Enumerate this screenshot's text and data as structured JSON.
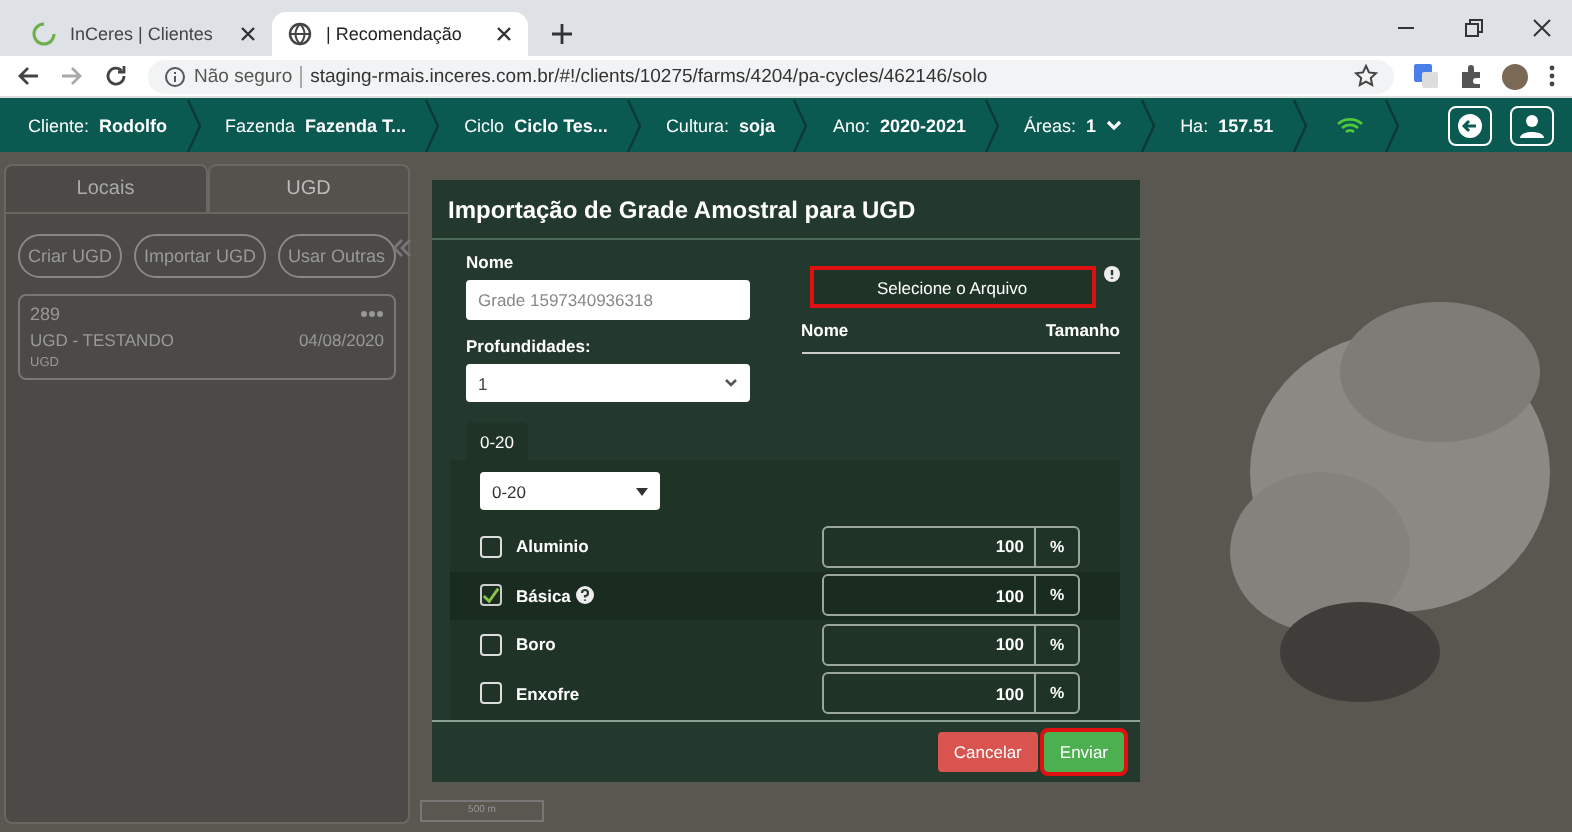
{
  "browser": {
    "tabs": [
      {
        "title": "InCeres | Clientes",
        "selected": false
      },
      {
        "title": "| Recomendação",
        "selected": true
      }
    ],
    "address": {
      "security": "Não seguro",
      "url": "staging-rmais.inceres.com.br/#!/clients/10275/farms/4204/pa-cycles/462146/solo"
    }
  },
  "nav": {
    "items": [
      {
        "label": "Cliente:",
        "value": "Rodolfo",
        "dropdown": false
      },
      {
        "label": "Fazenda",
        "value": "Fazenda T...",
        "dropdown": false
      },
      {
        "label": "Ciclo",
        "value": "Ciclo Tes...",
        "dropdown": false
      },
      {
        "label": "Cultura:",
        "value": "soja",
        "dropdown": false
      },
      {
        "label": "Ano:",
        "value": "2020-2021",
        "dropdown": false
      },
      {
        "label": "Áreas:",
        "value": "1",
        "dropdown": true
      },
      {
        "label": "Ha:",
        "value": "157.51",
        "dropdown": false
      }
    ]
  },
  "sidebar": {
    "tabs": [
      {
        "label": "Locais",
        "selected": false
      },
      {
        "label": "UGD",
        "selected": true
      }
    ],
    "actions": [
      "Criar UGD",
      "Importar UGD",
      "Usar Outras"
    ],
    "cards": [
      {
        "number": "289",
        "name": "UGD - TESTANDO",
        "date": "04/08/2020",
        "tag": "UGD"
      }
    ]
  },
  "modal": {
    "title": "Importação de Grade Amostral para UGD",
    "name_label": "Nome",
    "name_value": "Grade 1597340936318",
    "depth_label": "Profundidades:",
    "depth_value": "1",
    "file_button": "Selecione o Arquivo",
    "file_columns": [
      "Nome",
      "Tamanho"
    ],
    "depth_tabs": [
      {
        "label": "0-20",
        "selected": true
      }
    ],
    "layer_value": "0-20",
    "nutrients": [
      {
        "name": "Aluminio",
        "checked": false,
        "help": false,
        "value": "100",
        "unit": "%"
      },
      {
        "name": "Básica",
        "checked": true,
        "help": true,
        "value": "100",
        "unit": "%"
      },
      {
        "name": "Boro",
        "checked": false,
        "help": false,
        "value": "100",
        "unit": "%"
      },
      {
        "name": "Enxofre",
        "checked": false,
        "help": false,
        "value": "100",
        "unit": "%"
      }
    ],
    "buttons": [
      {
        "label": "Cancelar",
        "kind": "cancel"
      },
      {
        "label": "Enviar",
        "kind": "submit"
      }
    ]
  },
  "map": {
    "scale": "500 m"
  }
}
